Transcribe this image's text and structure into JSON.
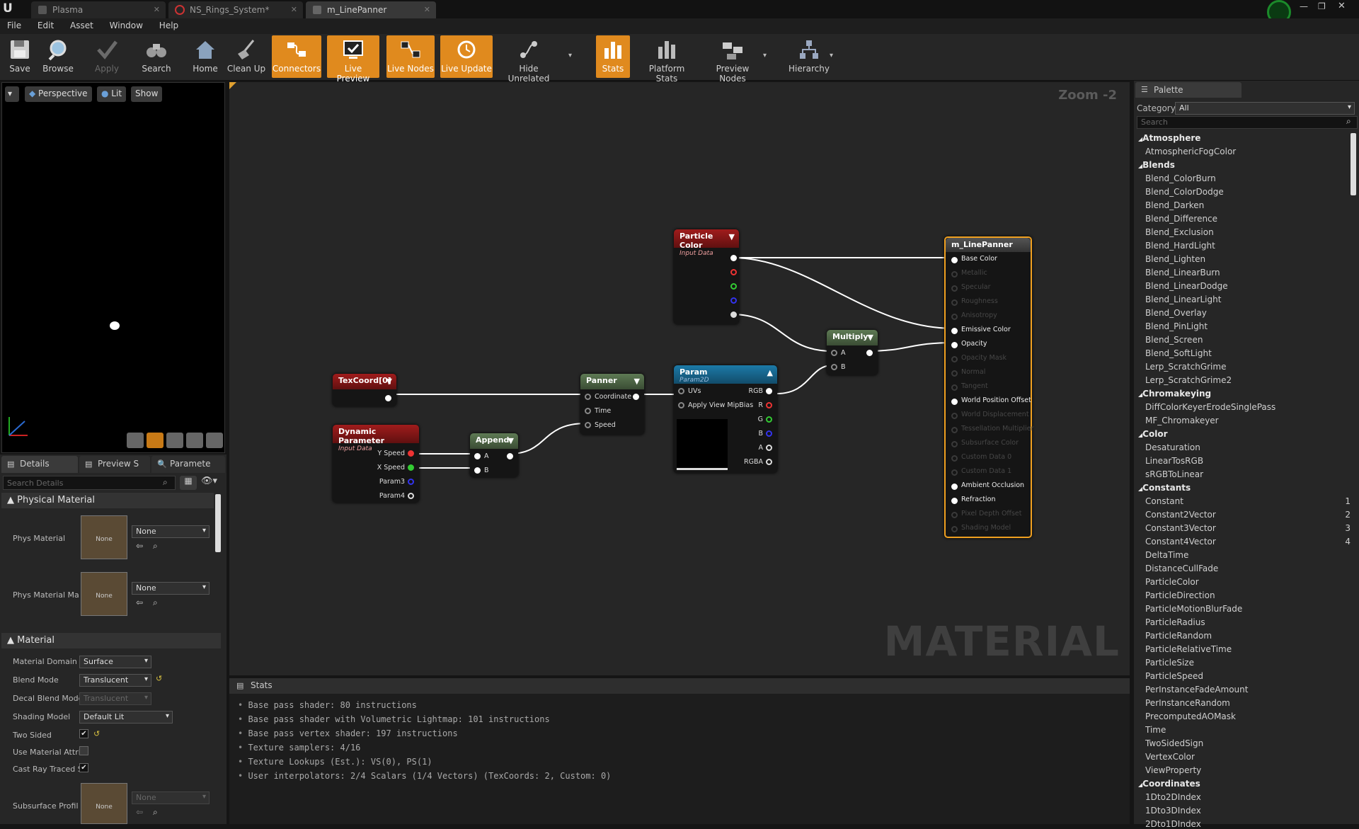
{
  "tabs": [
    {
      "label": "Plasma",
      "icon": "material-icon"
    },
    {
      "label": "NS_Rings_System*",
      "icon": "niagara-icon"
    },
    {
      "label": "m_LinePanner",
      "icon": "material-icon"
    }
  ],
  "menu": [
    "File",
    "Edit",
    "Asset",
    "Window",
    "Help"
  ],
  "toolbar": {
    "save": "Save",
    "browse": "Browse",
    "apply": "Apply",
    "search": "Search",
    "home": "Home",
    "cleanup": "Clean Up",
    "connectors": "Connectors",
    "live_preview": "Live Preview",
    "live_nodes": "Live Nodes",
    "live_update": "Live Update",
    "hide_unrelated": "Hide Unrelated",
    "stats": "Stats",
    "platform_stats": "Platform Stats",
    "preview_nodes": "Preview Nodes",
    "hierarchy": "Hierarchy",
    "accent_color": "#e08a1e"
  },
  "viewport": {
    "perspective": "Perspective",
    "lit": "Lit",
    "show": "Show"
  },
  "details_tabs": [
    "Details",
    "Preview S",
    "Paramete"
  ],
  "details": {
    "search_placeholder": "Search Details",
    "physical_material": {
      "title": "Physical Material",
      "phys_material": "Phys Material",
      "phys_material_mask": "Phys Material Ma",
      "thumb": "None",
      "combo": "None"
    },
    "material": {
      "title": "Material",
      "rows": [
        {
          "label": "Material Domain",
          "value": "Surface"
        },
        {
          "label": "Blend Mode",
          "value": "Translucent"
        },
        {
          "label": "Decal Blend Mode",
          "value": "Translucent"
        },
        {
          "label": "Shading Model",
          "value": "Default Lit"
        },
        {
          "label": "Two Sided",
          "checked": true
        },
        {
          "label": "Use Material Attri",
          "checked": false
        },
        {
          "label": "Cast Ray Traced S",
          "checked": true
        },
        {
          "label": "Subsurface Profil",
          "value": "None"
        }
      ]
    }
  },
  "graph": {
    "zoom": "Zoom -2",
    "watermark": "MATERIAL",
    "nodes": {
      "particle_color": {
        "title": "Particle Color",
        "subtitle": "Input Data"
      },
      "texcoord": {
        "title": "TexCoord[0]"
      },
      "dynamic_param": {
        "title": "Dynamic Parameter",
        "subtitle": "Input Data",
        "pins": [
          "Y Speed",
          "X Speed",
          "Param3",
          "Param4"
        ]
      },
      "append": {
        "title": "Append",
        "pins": [
          "A",
          "B"
        ]
      },
      "panner": {
        "title": "Panner",
        "pins": [
          "Coordinate",
          "Time",
          "Speed"
        ]
      },
      "param": {
        "title": "Param",
        "subtitle": "Param2D",
        "pins": [
          "UVs",
          "Apply View MipBias"
        ],
        "outputs": [
          "RGB",
          "R",
          "G",
          "B",
          "A",
          "RGBA"
        ]
      },
      "multiply": {
        "title": "Multiply",
        "pins": [
          "A",
          "B"
        ]
      },
      "result": {
        "title": "m_LinePanner",
        "pins": [
          {
            "label": "Base Color",
            "active": true
          },
          {
            "label": "Metallic",
            "active": false
          },
          {
            "label": "Specular",
            "active": false
          },
          {
            "label": "Roughness",
            "active": false
          },
          {
            "label": "Anisotropy",
            "active": false
          },
          {
            "label": "Emissive Color",
            "active": true
          },
          {
            "label": "Opacity",
            "active": true
          },
          {
            "label": "Opacity Mask",
            "active": false
          },
          {
            "label": "Normal",
            "active": false
          },
          {
            "label": "Tangent",
            "active": false
          },
          {
            "label": "World Position Offset",
            "active": true
          },
          {
            "label": "World Displacement",
            "active": false
          },
          {
            "label": "Tessellation Multiplier",
            "active": false
          },
          {
            "label": "Subsurface Color",
            "active": false
          },
          {
            "label": "Custom Data 0",
            "active": false
          },
          {
            "label": "Custom Data 1",
            "active": false
          },
          {
            "label": "Ambient Occlusion",
            "active": true
          },
          {
            "label": "Refraction",
            "active": true
          },
          {
            "label": "Pixel Depth Offset",
            "active": false
          },
          {
            "label": "Shading Model",
            "active": false
          }
        ]
      }
    }
  },
  "stats": {
    "title": "Stats",
    "lines": [
      "Base pass shader: 80 instructions",
      "Base pass shader with Volumetric Lightmap: 101 instructions",
      "Base pass vertex shader: 197 instructions",
      "Texture samplers: 4/16",
      "Texture Lookups (Est.): VS(0), PS(1)",
      "User interpolators: 2/4 Scalars (1/4 Vectors) (TexCoords: 2, Custom: 0)"
    ]
  },
  "palette": {
    "title": "Palette",
    "category_label": "Category:",
    "category_value": "All",
    "search_placeholder": "Search",
    "items": [
      {
        "t": "Atmosphere",
        "cat": true
      },
      {
        "t": "AtmosphericFogColor"
      },
      {
        "t": "Blends",
        "cat": true
      },
      {
        "t": "Blend_ColorBurn"
      },
      {
        "t": "Blend_ColorDodge"
      },
      {
        "t": "Blend_Darken"
      },
      {
        "t": "Blend_Difference"
      },
      {
        "t": "Blend_Exclusion"
      },
      {
        "t": "Blend_HardLight"
      },
      {
        "t": "Blend_Lighten"
      },
      {
        "t": "Blend_LinearBurn"
      },
      {
        "t": "Blend_LinearDodge"
      },
      {
        "t": "Blend_LinearLight"
      },
      {
        "t": "Blend_Overlay"
      },
      {
        "t": "Blend_PinLight"
      },
      {
        "t": "Blend_Screen"
      },
      {
        "t": "Blend_SoftLight"
      },
      {
        "t": "Lerp_ScratchGrime"
      },
      {
        "t": "Lerp_ScratchGrime2"
      },
      {
        "t": "Chromakeying",
        "cat": true
      },
      {
        "t": "DiffColorKeyerErodeSinglePass"
      },
      {
        "t": "MF_Chromakeyer"
      },
      {
        "t": "Color",
        "cat": true
      },
      {
        "t": "Desaturation"
      },
      {
        "t": "LinearTosRGB"
      },
      {
        "t": "sRGBToLinear"
      },
      {
        "t": "Constants",
        "cat": true
      },
      {
        "t": "Constant",
        "n": "1"
      },
      {
        "t": "Constant2Vector",
        "n": "2"
      },
      {
        "t": "Constant3Vector",
        "n": "3"
      },
      {
        "t": "Constant4Vector",
        "n": "4"
      },
      {
        "t": "DeltaTime"
      },
      {
        "t": "DistanceCullFade"
      },
      {
        "t": "ParticleColor"
      },
      {
        "t": "ParticleDirection"
      },
      {
        "t": "ParticleMotionBlurFade"
      },
      {
        "t": "ParticleRadius"
      },
      {
        "t": "ParticleRandom"
      },
      {
        "t": "ParticleRelativeTime"
      },
      {
        "t": "ParticleSize"
      },
      {
        "t": "ParticleSpeed"
      },
      {
        "t": "PerInstanceFadeAmount"
      },
      {
        "t": "PerInstanceRandom"
      },
      {
        "t": "PrecomputedAOMask"
      },
      {
        "t": "Time"
      },
      {
        "t": "TwoSidedSign"
      },
      {
        "t": "VertexColor"
      },
      {
        "t": "ViewProperty"
      },
      {
        "t": "Coordinates",
        "cat": true
      },
      {
        "t": "1Dto2DIndex"
      },
      {
        "t": "1Dto3DIndex"
      },
      {
        "t": "2Dto1DIndex"
      }
    ]
  }
}
